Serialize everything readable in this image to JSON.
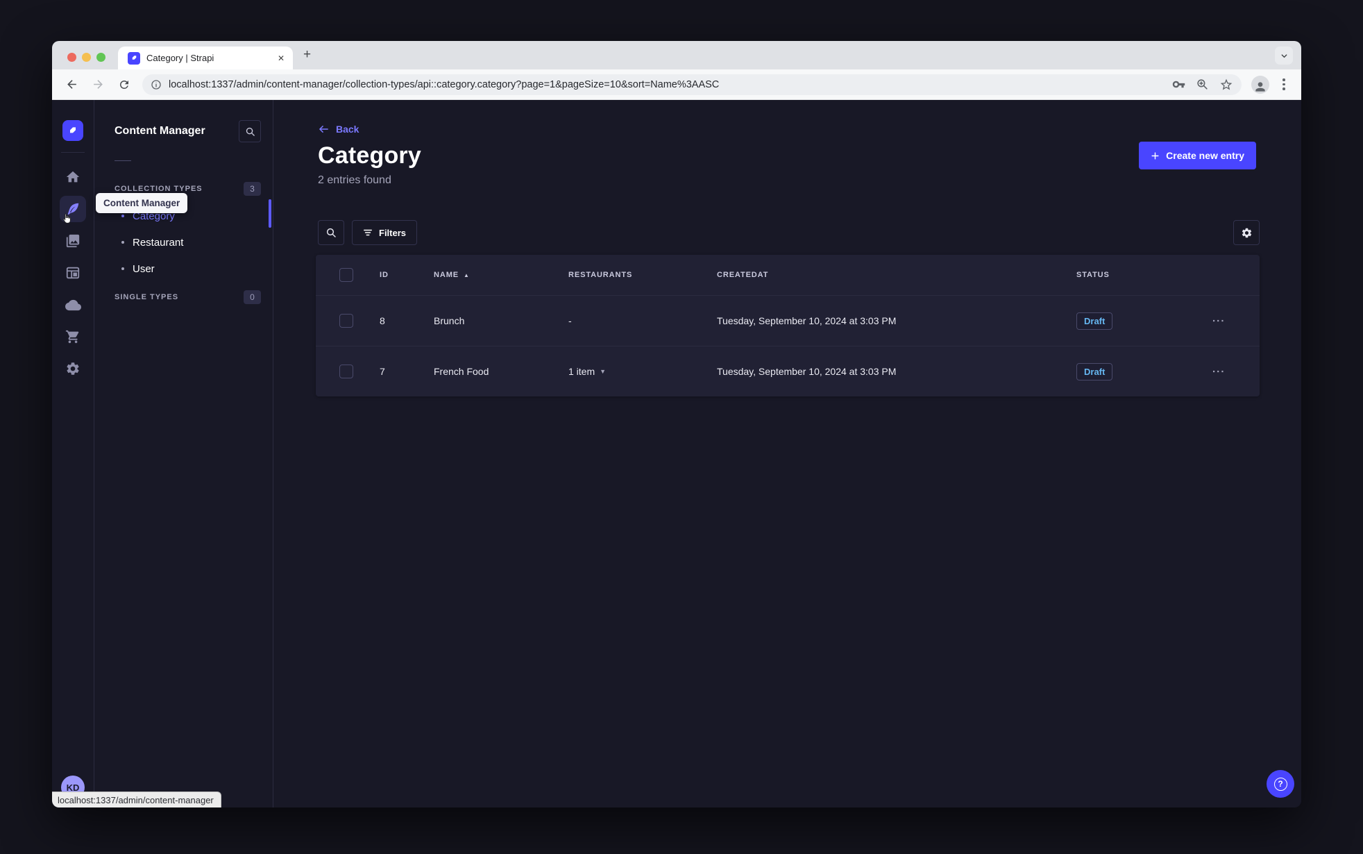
{
  "colors": {
    "accent": "#4945ff",
    "link": "#7b79ff",
    "draft_status": "#66b7f1",
    "app_background": "#181826",
    "panel_background": "#212134",
    "panel_border": "#32324d"
  },
  "browser": {
    "tab_title": "Category | Strapi",
    "url": "localhost:1337/admin/content-manager/collection-types/api::category.category?page=1&pageSize=10&sort=Name%3AASC",
    "status_bubble_text": "localhost:1337/admin/content-manager",
    "new_tab_label": "+"
  },
  "iconbar": {
    "icons": [
      {
        "name": "strapi-logo"
      },
      {
        "name": "home-icon"
      },
      {
        "name": "content-manager-icon",
        "active": true,
        "tooltip": "Content Manager"
      },
      {
        "name": "media-library-icon"
      },
      {
        "name": "content-type-builder-icon"
      },
      {
        "name": "deploy-cloud-icon"
      },
      {
        "name": "marketplace-icon"
      },
      {
        "name": "settings-icon"
      }
    ],
    "avatar_initials": "KD"
  },
  "subnav": {
    "title": "Content Manager",
    "tooltip": "Content Manager",
    "sections": [
      {
        "label": "COLLECTION TYPES",
        "badge": "3",
        "items": [
          {
            "label": "Category",
            "active": true
          },
          {
            "label": "Restaurant",
            "active": false
          },
          {
            "label": "User",
            "active": false
          }
        ]
      },
      {
        "label": "SINGLE TYPES",
        "badge": "0",
        "items": []
      }
    ]
  },
  "main": {
    "back_label": "Back",
    "title": "Category",
    "subtitle": "2 entries found",
    "create_button_label": "Create new entry",
    "filters_button_label": "Filters",
    "table": {
      "columns": [
        "ID",
        "NAME",
        "RESTAURANTS",
        "CREATEDAT",
        "STATUS"
      ],
      "sorted_column": "NAME",
      "sort_direction": "ASC",
      "rows": [
        {
          "id": "8",
          "name": "Brunch",
          "restaurants": "-",
          "restaurants_expandable": false,
          "createdat": "Tuesday, September 10, 2024 at 3:03 PM",
          "status": "Draft"
        },
        {
          "id": "7",
          "name": "French Food",
          "restaurants": "1 item",
          "restaurants_expandable": true,
          "createdat": "Tuesday, September 10, 2024 at 3:03 PM",
          "status": "Draft"
        }
      ]
    },
    "help_label": "?"
  }
}
